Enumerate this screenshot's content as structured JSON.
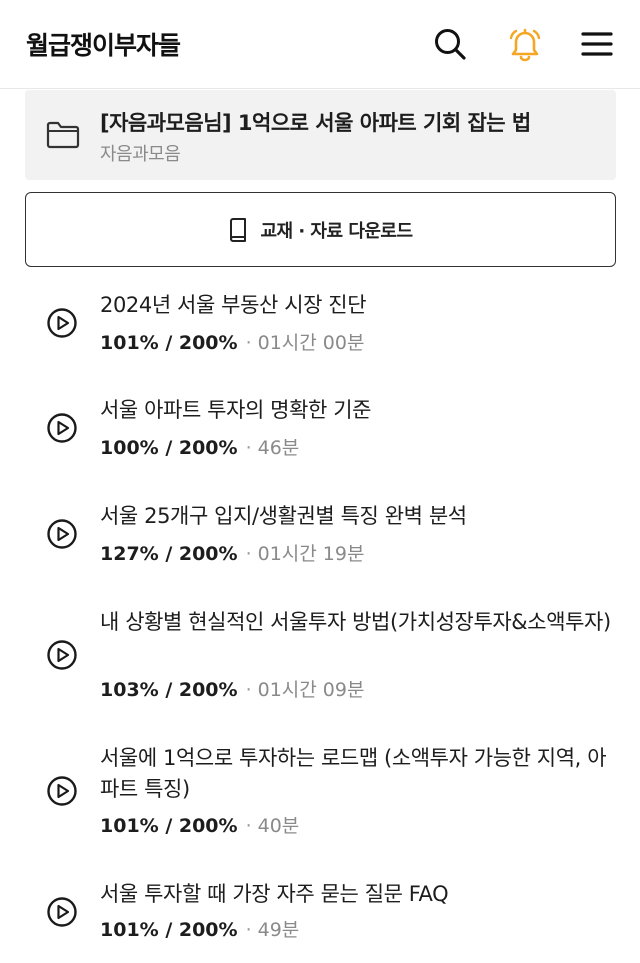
{
  "header": {
    "logo": "월급쟁이부자들",
    "icons": [
      "search-icon",
      "bell-icon",
      "menu-icon"
    ],
    "bell_color": "#f5a623"
  },
  "course": {
    "title": "[자음과모음님] 1억으로 서울 아파트 기회 잡는 법",
    "subtitle": "자음과모음",
    "icon": "folder-icon"
  },
  "download": {
    "label": "교재 · 자료 다운로드",
    "icon": "book-icon"
  },
  "lessons": [
    {
      "title": "2024년 서울 부동산 시장 진단",
      "progress": "101% / 200%",
      "duration": "01시간 00분"
    },
    {
      "title": "서울 아파트 투자의 명확한 기준",
      "progress": "100% / 200%",
      "duration": "46분"
    },
    {
      "title": "서울 25개구 입지/생활권별 특징 완벽 분석",
      "progress": "127% / 200%",
      "duration": "01시간 19분"
    },
    {
      "title": "내 상황별 현실적인 서울투자 방법(가치성장투자&소액투자)",
      "progress": "103% / 200%",
      "duration": "01시간 09분"
    },
    {
      "title": "서울에 1억으로 투자하는 로드맵 (소액투자 가능한 지역, 아파트 특징)",
      "progress": "101% / 200%",
      "duration": "40분"
    },
    {
      "title": "서울 투자할 때 가장 자주 묻는 질문 FAQ",
      "progress": "101% / 200%",
      "duration": "49분"
    }
  ],
  "separator": "·"
}
